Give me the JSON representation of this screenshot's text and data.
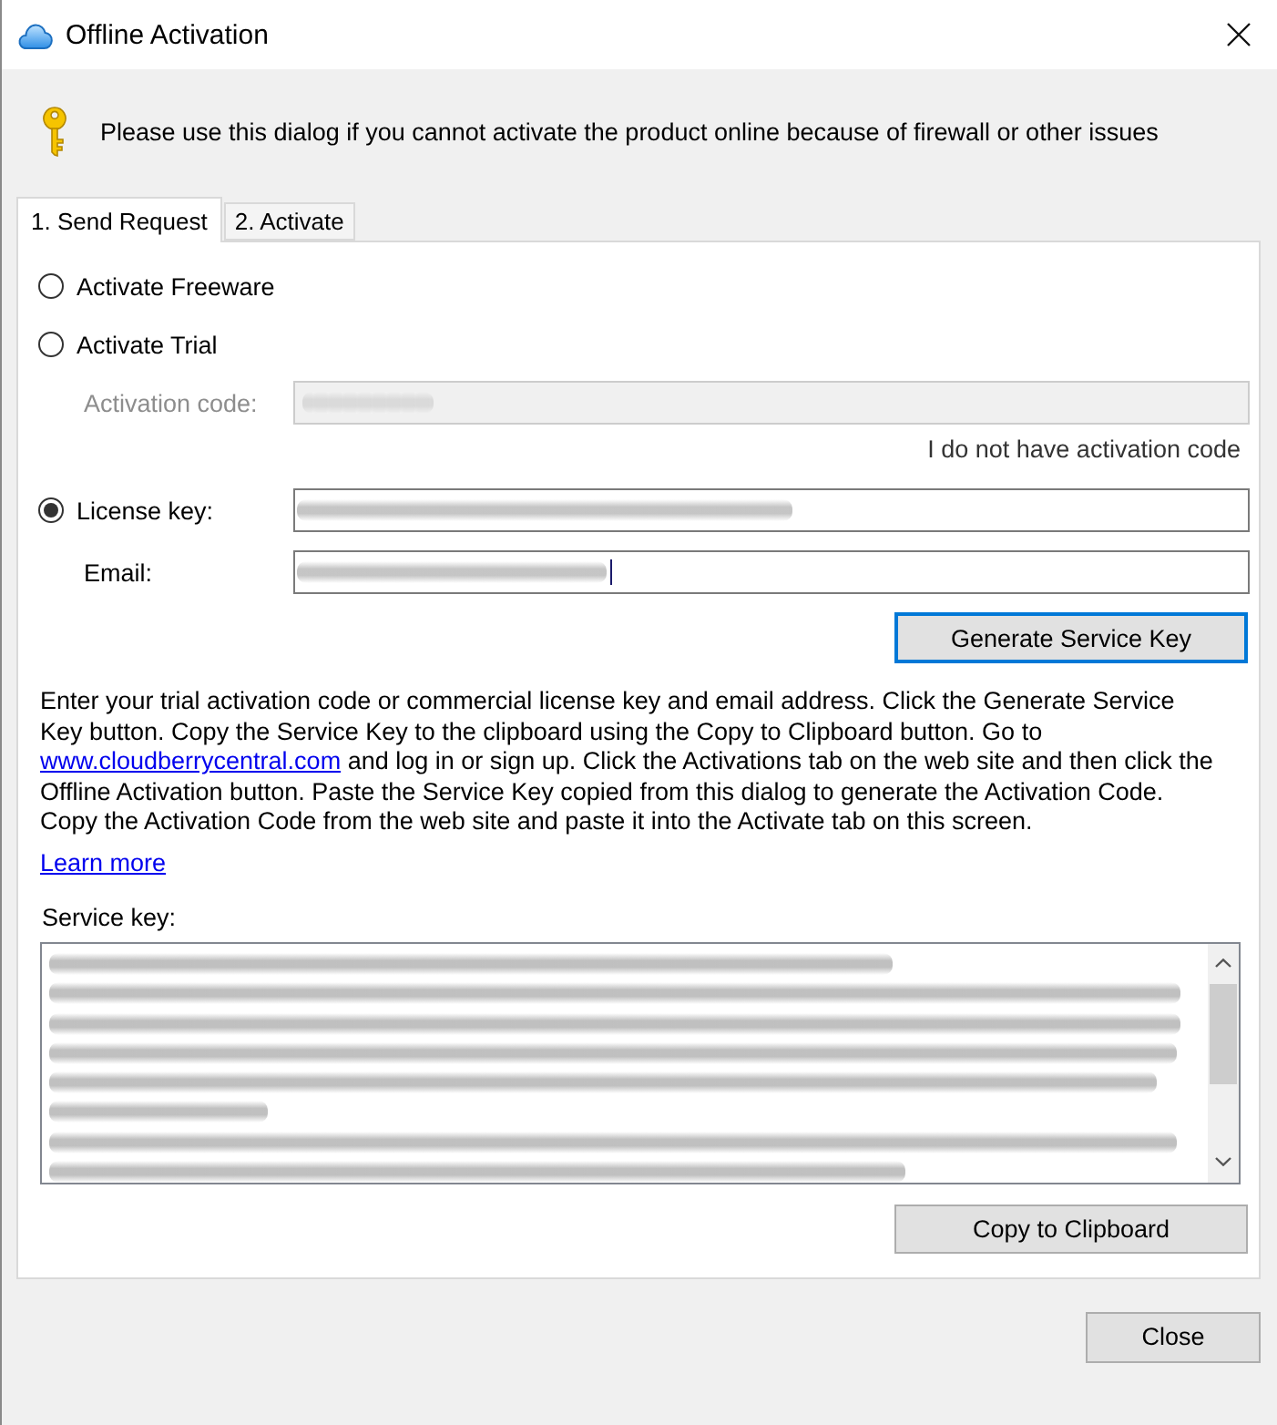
{
  "window": {
    "title": "Offline Activation"
  },
  "notice": "Please use this dialog if you cannot activate the product online because of firewall or other issues",
  "tabs": [
    {
      "label": "1. Send Request",
      "selected": true
    },
    {
      "label": "2. Activate",
      "selected": false
    }
  ],
  "options": [
    {
      "label": "Activate Freeware",
      "selected": false
    },
    {
      "label": "Activate Trial",
      "selected": false,
      "fields": [
        {
          "label": "Activation code:",
          "disabled": true,
          "redacted": true
        }
      ],
      "note": "I do not have activation code"
    },
    {
      "label": "License key:",
      "selected": true,
      "inline_field": {
        "disabled": false,
        "redacted": true
      },
      "fields": [
        {
          "label": "Email:",
          "disabled": false,
          "redacted": true,
          "focused": true
        }
      ]
    }
  ],
  "generate_button": {
    "label": "Generate Service Key",
    "focused": true
  },
  "instructions": {
    "before": "Enter your trial activation code or commercial license key and email address. Click the Generate Service Key button. Copy the Service Key to the clipboard using the Copy to Clipboard button. Go to ",
    "link": "www.cloudberrycentral.com",
    "after": " and log in or sign up. Click the Activations tab on the web site and then click the Offline Activation button. Paste the Service Key copied from this dialog to generate the Activation Code. Copy the Activation Code from the web site and paste it into the Activate tab on this screen."
  },
  "learn_more": "Learn more",
  "service_key": {
    "label": "Service key:",
    "redacted": true
  },
  "copy_button": "Copy to Clipboard",
  "close_button": "Close"
}
